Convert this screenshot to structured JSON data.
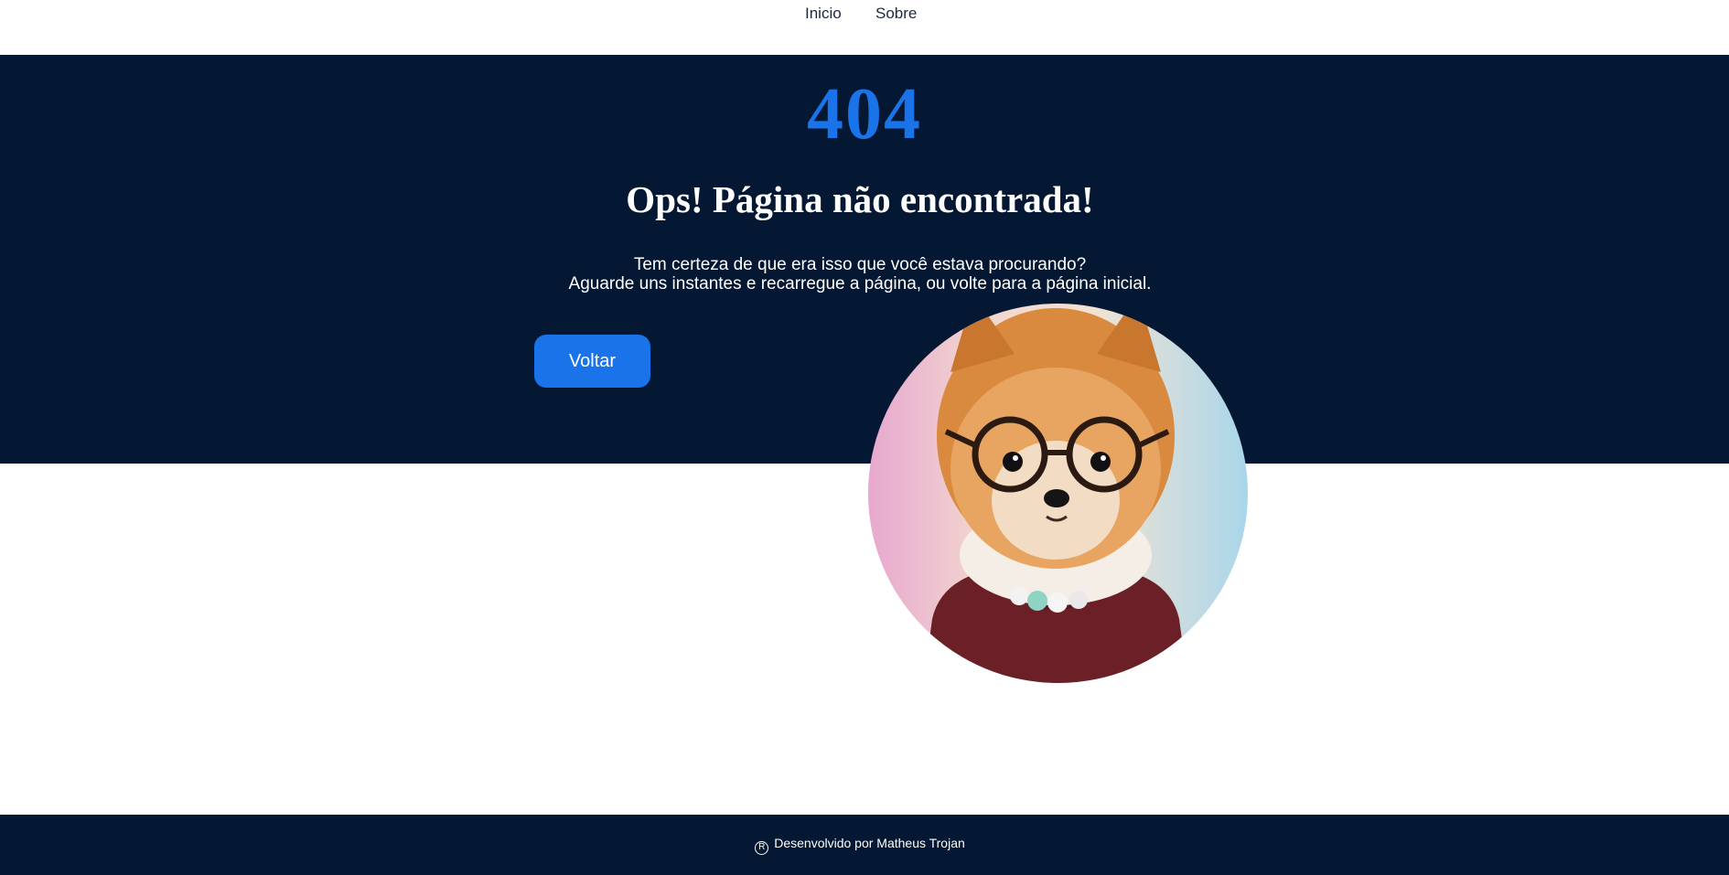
{
  "nav": {
    "links": [
      {
        "label": "Inicio"
      },
      {
        "label": "Sobre"
      }
    ]
  },
  "hero": {
    "code": "404",
    "title": "Ops! Página não encontrada!",
    "lines": [
      "Tem certeza de que era isso que você estava procurando?",
      "Aguarde uns instantes e recarregue a página, ou volte para a página inicial."
    ],
    "button_label": "Voltar"
  },
  "image": {
    "subject": "pomeranian-dog-with-glasses",
    "icon": "dog-illustration"
  },
  "footer": {
    "icon": "registered-icon",
    "icon_glyph": "R",
    "text": "Desenvolvido por Matheus Trojan"
  },
  "colors": {
    "navy": "#041733",
    "accent": "#1a73e8",
    "white": "#ffffff"
  }
}
